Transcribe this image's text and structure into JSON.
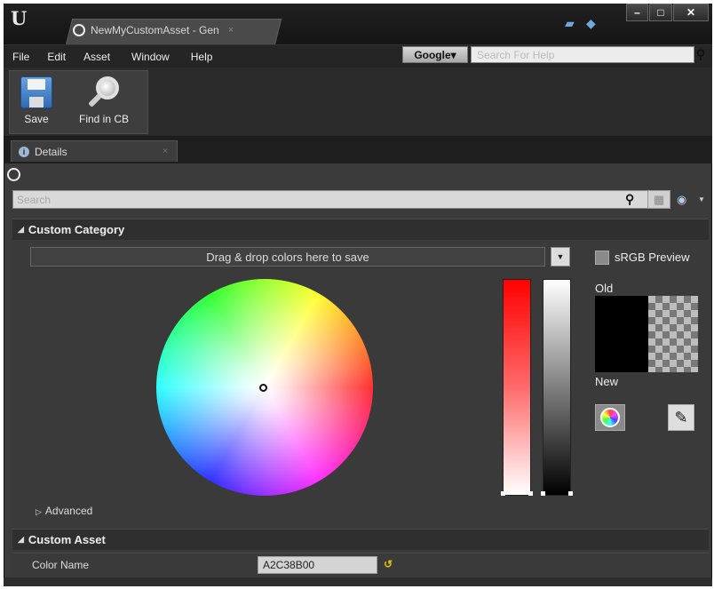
{
  "window": {
    "logo": "U",
    "tab_title": "NewMyCustomAsset - Gen",
    "tab_close": "×",
    "notify_icon": "speech-bubble-icon",
    "learn_icon": "graduation-cap-icon",
    "controls": [
      "–",
      "□",
      "✕"
    ]
  },
  "menu": {
    "items": [
      "File",
      "Edit",
      "Asset",
      "Window",
      "Help"
    ],
    "search_provider": "Google▾",
    "search_placeholder": "Search For Help"
  },
  "toolbar": {
    "save_label": "Save",
    "find_label": "Find in CB"
  },
  "details": {
    "tab_label": "Details",
    "tab_close": "×",
    "search_placeholder": "Search"
  },
  "custom_category": {
    "header": "Custom Category",
    "dropzone_text": "Drag & drop colors here to save",
    "srgb_label": "sRGB Preview",
    "old_label": "Old",
    "new_label": "New",
    "advanced_label": "Advanced"
  },
  "custom_asset": {
    "header": "Custom Asset",
    "color_name_label": "Color Name",
    "color_name_value": "A2C38B00"
  },
  "colors": {
    "old_swatch": "#000000",
    "accent_reset": "#e5c400"
  }
}
